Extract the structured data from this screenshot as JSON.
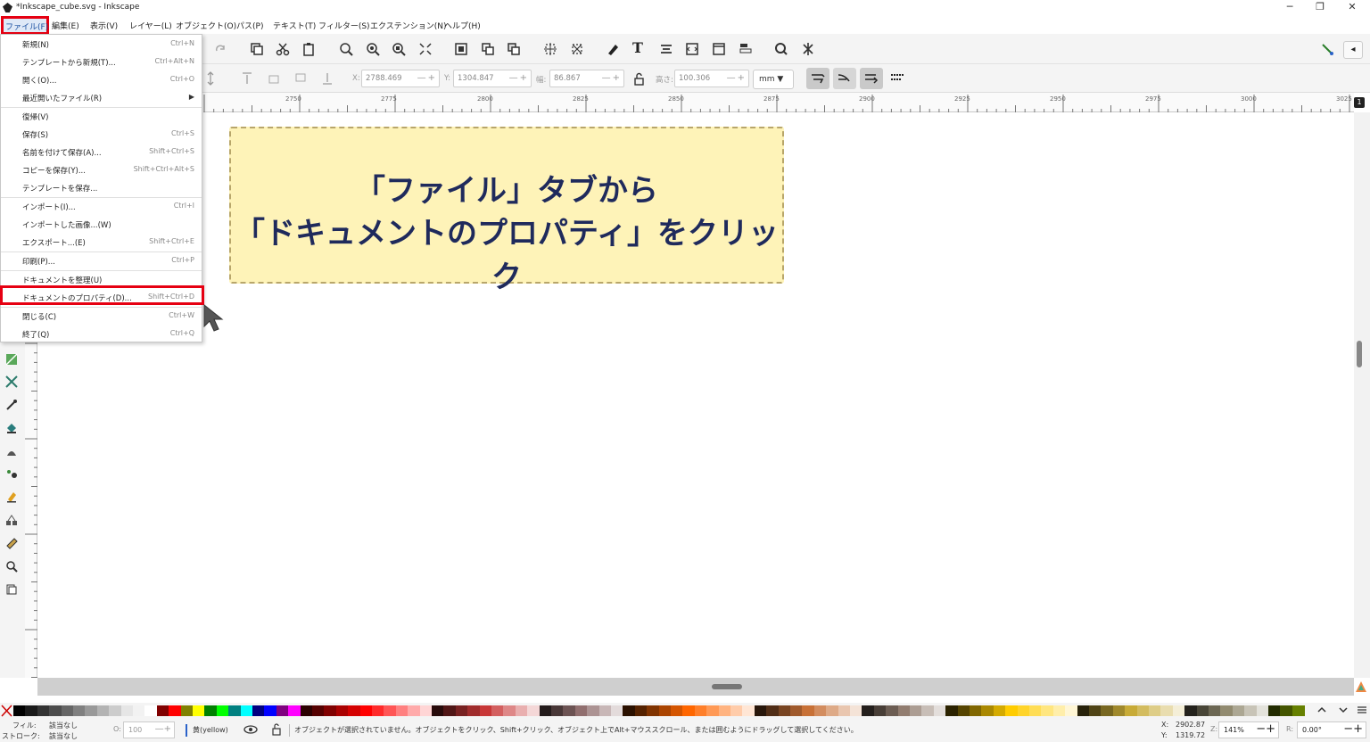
{
  "window": {
    "title": "*Inkscape_cube.svg - Inkscape",
    "minimize_glyph": "─",
    "restore_glyph": "❐",
    "close_glyph": "✕"
  },
  "menubar": {
    "items": [
      "ファイル(F)",
      "編集(E)",
      "表示(V)",
      "レイヤー(L)",
      "オブジェクト(O)",
      "パス(P)",
      "テキスト(T)",
      "フィルター(S)",
      "エクステンション(N)",
      "ヘルプ(H)"
    ]
  },
  "file_menu": {
    "items": [
      {
        "label": "新規(N)",
        "shortcut": "Ctrl+N"
      },
      {
        "label": "テンプレートから新規(T)...",
        "shortcut": "Ctrl+Alt+N"
      },
      {
        "label": "開く(O)...",
        "shortcut": "Ctrl+O"
      },
      {
        "label": "最近開いたファイル(R)",
        "shortcut": "▶"
      },
      {
        "label": "復帰(V)",
        "shortcut": ""
      },
      {
        "label": "保存(S)",
        "shortcut": "Ctrl+S"
      },
      {
        "label": "名前を付けて保存(A)...",
        "shortcut": "Shift+Ctrl+S"
      },
      {
        "label": "コピーを保存(Y)...",
        "shortcut": "Shift+Ctrl+Alt+S"
      },
      {
        "label": "テンプレートを保存...",
        "shortcut": ""
      },
      {
        "label": "インポート(I)...",
        "shortcut": "Ctrl+I"
      },
      {
        "label": "インポートした画像...(W)",
        "shortcut": ""
      },
      {
        "label": "エクスポート...(E)",
        "shortcut": "Shift+Ctrl+E"
      },
      {
        "label": "印刷(P)...",
        "shortcut": "Ctrl+P"
      },
      {
        "label": "ドキュメントを整理(U)",
        "shortcut": ""
      },
      {
        "label": "ドキュメントのプロパティ(D)...",
        "shortcut": "Shift+Ctrl+D"
      },
      {
        "label": "閉じる(C)",
        "shortcut": "Ctrl+W"
      },
      {
        "label": "終了(Q)",
        "shortcut": "Ctrl+Q"
      }
    ]
  },
  "controls": {
    "x_label": "X:",
    "x_value": "2788.469",
    "y_label": "Y:",
    "y_value": "1304.847",
    "w_label": "幅:",
    "w_value": "86.867",
    "h_label": "高さ:",
    "h_value": "100.306",
    "unit": "mm"
  },
  "ruler": {
    "ticks": [
      "2750",
      "2775",
      "2800",
      "2825",
      "2850",
      "2875",
      "2900",
      "2925",
      "2950",
      "2975",
      "3000",
      "3025"
    ],
    "badge": "1"
  },
  "callout": {
    "line1": "「ファイル」タブから",
    "line2": "「ドキュメントのプロパティ」をクリック"
  },
  "status": {
    "fill_label": "フィル:",
    "fill_value": "該当なし",
    "stroke_label": "ストローク:",
    "stroke_value": "該当なし",
    "opacity_label": "O:",
    "opacity_value": "100",
    "layer": "黄(yellow)",
    "message": "オブジェクトが選択されていません。オブジェクトをクリック、Shift+クリック、オブジェクト上でAlt+マウススクロール、または囲むようにドラッグして選択してください。",
    "cursor_x": "2902.87",
    "cursor_y": "1319.72",
    "x_label": "X:",
    "y_label": "Y:",
    "zoom_label": "Z:",
    "zoom": "141%",
    "rotate_label": "R:",
    "rotation": "0.00°"
  },
  "colors": {
    "highlight": "#e60012",
    "callout_bg": "#fef3b8",
    "callout_text": "#1f2a5c"
  }
}
